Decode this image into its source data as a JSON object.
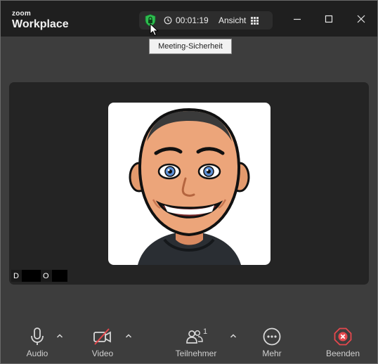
{
  "app": {
    "brand_small": "zoom",
    "brand_big": "Workplace"
  },
  "header": {
    "timer": "00:01:19",
    "view_label": "Ansicht",
    "security_tooltip": "Meeting-Sicherheit",
    "security_color": "#2ebd4f"
  },
  "window_controls": [
    "minimize-icon",
    "maximize-icon",
    "close-icon"
  ],
  "participant": {
    "initial_first": "D",
    "initial_last": "O"
  },
  "toolbar": {
    "audio_label": "Audio",
    "video_label": "Video",
    "participants_label": "Teilnehmer",
    "participants_count": "1",
    "more_label": "Mehr",
    "end_label": "Beenden",
    "end_color": "#e5484d",
    "video_off_color": "#e5484d"
  }
}
